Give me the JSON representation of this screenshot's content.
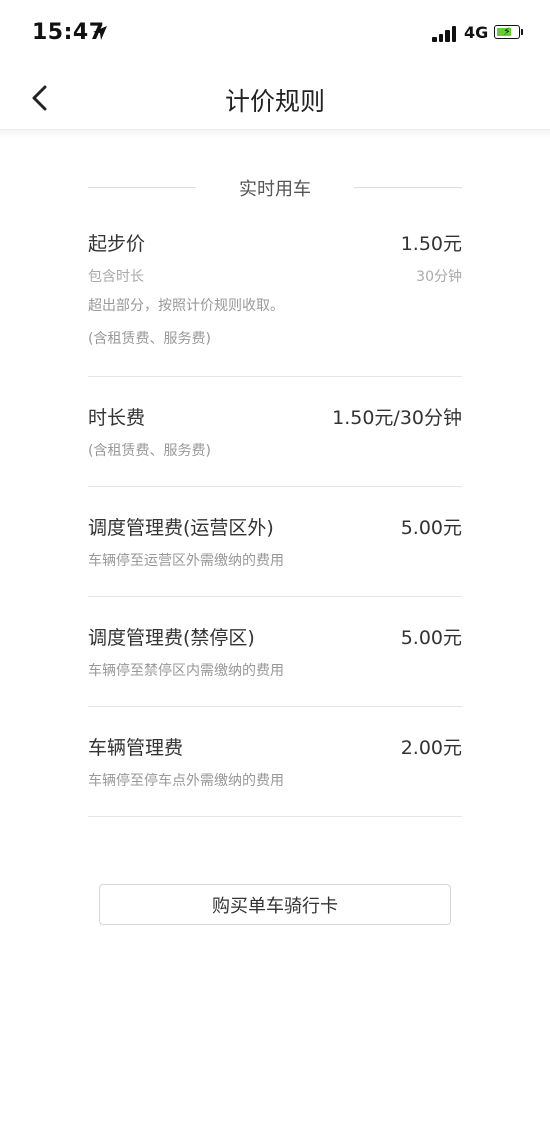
{
  "status_bar": {
    "time": "15:47",
    "network": "4G",
    "icons": [
      "location-arrow-icon",
      "signal-icon",
      "battery-icon"
    ]
  },
  "nav": {
    "title": "计价规则",
    "back_icon": "chevron-left-icon"
  },
  "section": {
    "title": "实时用车"
  },
  "fees": [
    {
      "name": "起步价",
      "price": "1.50元",
      "sub_label": "包含时长",
      "sub_value": "30分钟",
      "note1": "超出部分，按照计价规则收取。",
      "note2": "(含租赁费、服务费)"
    },
    {
      "name": "时长费",
      "price": "1.50元/30分钟",
      "note1": "(含租赁费、服务费)"
    },
    {
      "name": "调度管理费(运营区外)",
      "price": "5.00元",
      "note1": "车辆停至运营区外需缴纳的费用"
    },
    {
      "name": "调度管理费(禁停区)",
      "price": "5.00元",
      "note1": "车辆停至禁停区内需缴纳的费用"
    },
    {
      "name": "车辆管理费",
      "price": "2.00元",
      "note1": "车辆停至停车点外需缴纳的费用"
    }
  ],
  "buy_button": {
    "label": "购买单车骑行卡"
  },
  "colors": {
    "battery_fill": "#66cc33",
    "divider": "#e5e5e5",
    "secondary_text": "#999999"
  }
}
